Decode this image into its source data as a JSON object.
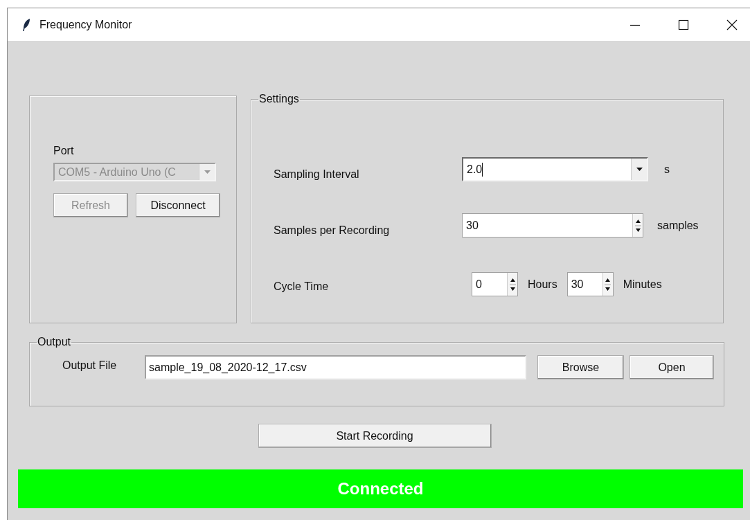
{
  "window": {
    "title": "Frequency Monitor"
  },
  "connection": {
    "port_label": "Port",
    "port": {
      "value": "COM5 - Arduino Uno (C",
      "disabled": true
    },
    "buttons": [
      {
        "label": "Refresh",
        "disabled": true
      },
      {
        "label": "Disconnect",
        "disabled": false
      }
    ]
  },
  "settings": {
    "title": "Settings",
    "rows": [
      {
        "label": "Sampling Interval",
        "kind": "combobox",
        "value": "2.0",
        "unit": "s",
        "focused": true
      },
      {
        "label": "Samples per Recording",
        "kind": "spinbox",
        "value": "30",
        "unit": "samples"
      },
      {
        "label": "Cycle Time",
        "kind": "duration",
        "fields": [
          {
            "value": "0",
            "unit": "Hours"
          },
          {
            "value": "30",
            "unit": "Minutes"
          }
        ]
      }
    ]
  },
  "output": {
    "title": "Output",
    "label": "Output File",
    "value": "sample_19_08_2020-12_17.csv",
    "buttons": [
      "Browse",
      "Open"
    ]
  },
  "start_button": "Start Recording",
  "status": {
    "text": "Connected",
    "connected": true
  }
}
